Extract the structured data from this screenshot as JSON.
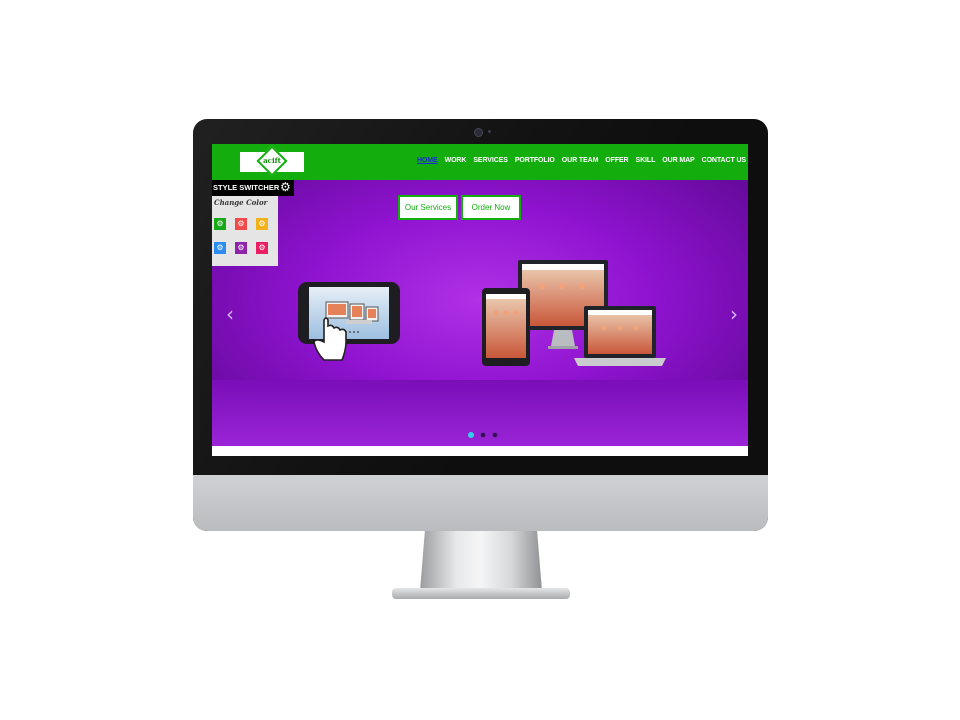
{
  "logo": {
    "text": "acift"
  },
  "nav": {
    "items": [
      {
        "label": "HOME",
        "active": true
      },
      {
        "label": "WORK"
      },
      {
        "label": "SERVICES"
      },
      {
        "label": "PORTFOLIO"
      },
      {
        "label": "OUR TEAM"
      },
      {
        "label": "OFFER"
      },
      {
        "label": "SKILL"
      },
      {
        "label": "OUR MAP"
      },
      {
        "label": "CONTACT US"
      }
    ]
  },
  "hero": {
    "buttons": {
      "services": "Our Services",
      "order": "Order Now"
    },
    "prev_icon": "chevron-left-icon",
    "next_icon": "chevron-right-icon",
    "dots": {
      "count": 3,
      "active": 1
    }
  },
  "style_switcher": {
    "title": "STYLE SWITCHER",
    "change_color_label": "Change Color",
    "gear_icon": "gear-icon",
    "colors": [
      "#17a917",
      "#f04a4a",
      "#f2b21a",
      "#2d8cf0",
      "#8e24aa",
      "#e91e63"
    ]
  },
  "colors": {
    "nav_bg": "#13ad0e",
    "hero_bg": "#9b1fd8",
    "active_link": "#1a2bd6"
  }
}
